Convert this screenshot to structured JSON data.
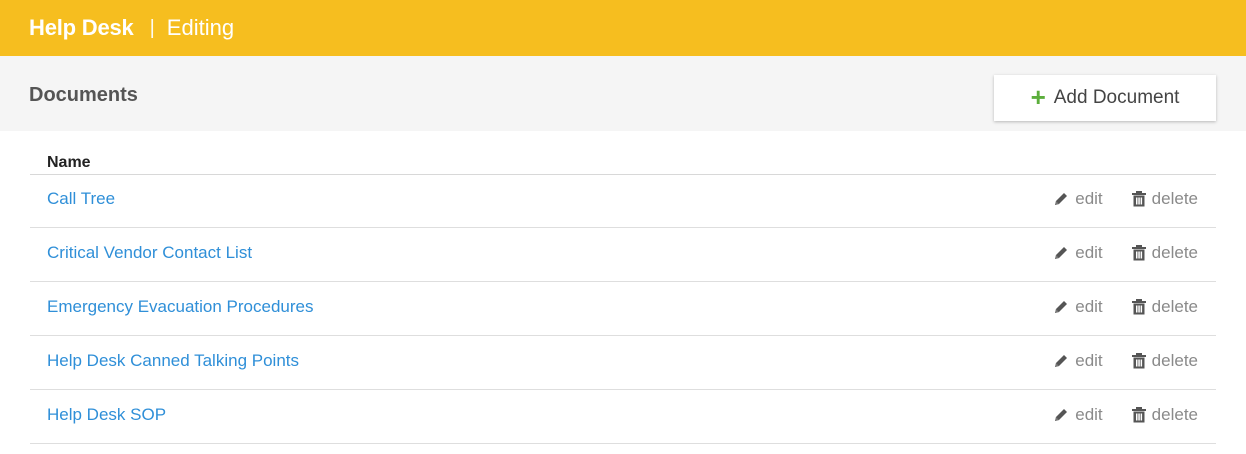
{
  "header": {
    "app_title": "Help Desk",
    "separator": "|",
    "mode": "Editing"
  },
  "section": {
    "title": "Documents",
    "add_button_label": "Add Document"
  },
  "table": {
    "column_name": "Name",
    "action_edit": "edit",
    "action_delete": "delete",
    "rows": [
      {
        "name": "Call Tree"
      },
      {
        "name": "Critical Vendor Contact List"
      },
      {
        "name": "Emergency Evacuation Procedures"
      },
      {
        "name": "Help Desk Canned Talking Points"
      },
      {
        "name": "Help Desk SOP"
      }
    ]
  },
  "colors": {
    "header_bg": "#f6be1f",
    "link": "#2f8fd8",
    "plus": "#5cae3c"
  },
  "icons": {
    "add": "plus-icon",
    "edit": "pencil-icon",
    "delete": "trash-icon"
  }
}
